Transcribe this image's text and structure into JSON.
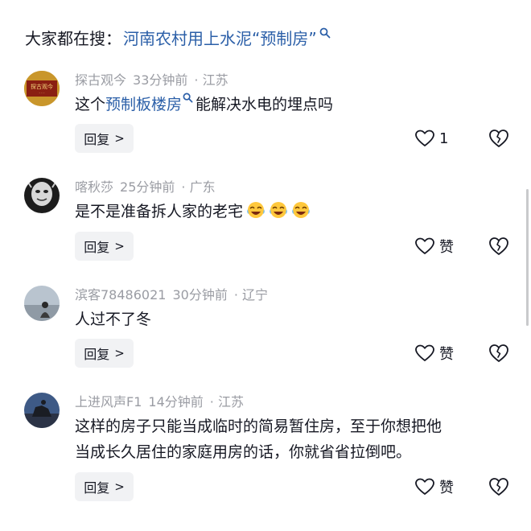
{
  "search": {
    "prefix": "大家都在搜：",
    "query": "河南农村用上水泥“预制房”"
  },
  "comments": [
    {
      "username": "探古观今",
      "time": "33分钟前",
      "location": "· 江苏",
      "text_before": "这个",
      "text_link": "预制板楼房",
      "text_after": "能解决水电的埋点吗",
      "reply_label": "回复",
      "like_text": "1"
    },
    {
      "username": "喀秋莎",
      "time": "25分钟前",
      "location": "· 广东",
      "text": "是不是准备拆人家的老宅",
      "emojis": [
        "cry-laugh-emoji",
        "cry-laugh-emoji",
        "cry-laugh-emoji"
      ],
      "reply_label": "回复",
      "like_text": "赞"
    },
    {
      "username": "滨客78486021",
      "time": "30分钟前",
      "location": "· 辽宁",
      "text": "人过不了冬",
      "reply_label": "回复",
      "like_text": "赞"
    },
    {
      "username": "上进风声F1",
      "time": "14分钟前",
      "location": "· 江苏",
      "text_line1": "这样的房子只能当成临时的简易暂住房，至于你想把他",
      "text_line2": "当成长久居住的家庭用房的话，你就省省拉倒吧。",
      "reply_label": "回复",
      "like_text": "赞"
    }
  ],
  "avatar_logo_text": "探古观今",
  "colors": {
    "link": "#2b5fa8",
    "meta": "#9a9ca3",
    "reply_bg": "#f1f2f4"
  }
}
